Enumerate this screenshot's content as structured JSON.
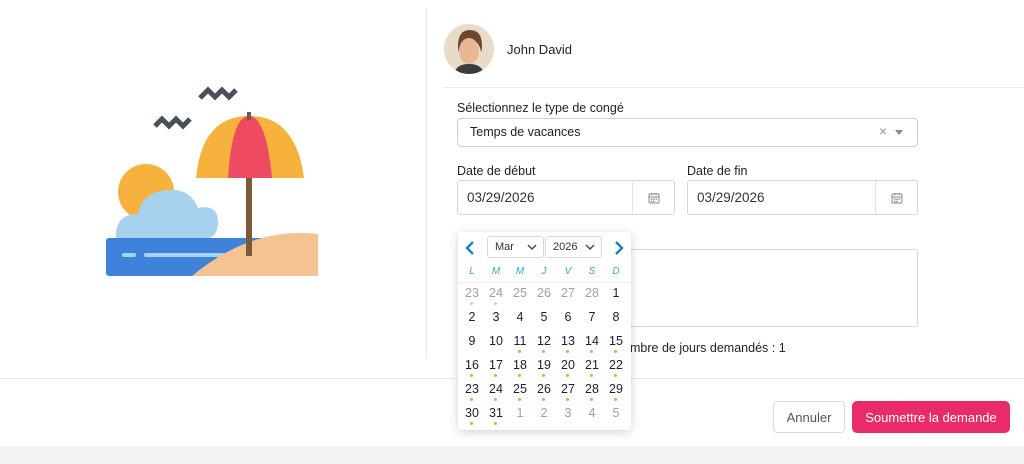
{
  "user": {
    "name": "John David"
  },
  "form": {
    "leave_type_label": "Sélectionnez le type de congé",
    "leave_type_value": "Temps de vacances",
    "clear_symbol": "×",
    "start_label": "Date de début",
    "start_value": "03/29/2026",
    "end_label": "Date de fin",
    "end_value": "03/29/2026",
    "days_text": "mbre de jours demandés : 1"
  },
  "buttons": {
    "cancel": "Annuler",
    "submit": "Soumettre la demande"
  },
  "calendar": {
    "month": "Mar",
    "year": "2026",
    "weekdays": [
      "L",
      "M",
      "M",
      "J",
      "V",
      "S",
      "D"
    ],
    "weeks": [
      [
        {
          "d": "23",
          "muted": true,
          "dot": "grey"
        },
        {
          "d": "24",
          "muted": true,
          "dot": "grey"
        },
        {
          "d": "25",
          "muted": true
        },
        {
          "d": "26",
          "muted": true
        },
        {
          "d": "27",
          "muted": true
        },
        {
          "d": "28",
          "muted": true
        },
        {
          "d": "1"
        }
      ],
      [
        {
          "d": "2"
        },
        {
          "d": "3"
        },
        {
          "d": "4"
        },
        {
          "d": "5"
        },
        {
          "d": "6"
        },
        {
          "d": "7"
        },
        {
          "d": "8"
        }
      ],
      [
        {
          "d": "9"
        },
        {
          "d": "10"
        },
        {
          "d": "11",
          "dot": "orange"
        },
        {
          "d": "12",
          "dot": "orange"
        },
        {
          "d": "13",
          "dot": "orange"
        },
        {
          "d": "14",
          "dot": "orange"
        },
        {
          "d": "15",
          "dot": "orange"
        }
      ],
      [
        {
          "d": "16",
          "dot": "orange"
        },
        {
          "d": "17",
          "dot": "orange"
        },
        {
          "d": "18",
          "dot": "orange"
        },
        {
          "d": "19",
          "dot": "orange"
        },
        {
          "d": "20",
          "dot": "orange"
        },
        {
          "d": "21",
          "dot": "orange"
        },
        {
          "d": "22",
          "dot": "orange"
        }
      ],
      [
        {
          "d": "23",
          "dot": "orange"
        },
        {
          "d": "24",
          "dot": "orange"
        },
        {
          "d": "25",
          "dot": "orange"
        },
        {
          "d": "26",
          "dot": "orange"
        },
        {
          "d": "27",
          "dot": "orange"
        },
        {
          "d": "28",
          "dot": "orange"
        },
        {
          "d": "29",
          "dot": "orange"
        }
      ],
      [
        {
          "d": "30",
          "dot": "orange"
        },
        {
          "d": "31",
          "dot": "orange"
        },
        {
          "d": "1",
          "muted": true
        },
        {
          "d": "2",
          "muted": true
        },
        {
          "d": "3",
          "muted": true
        },
        {
          "d": "4",
          "muted": true
        },
        {
          "d": "5",
          "muted": true
        }
      ]
    ]
  },
  "colors": {
    "accent": "#ea2b6a",
    "calendar_blue": "#1f7fb6",
    "dot_orange": "#e7a638"
  },
  "icons": [
    "beach-illustration",
    "calendar-icon",
    "chevron-left-icon",
    "chevron-right-icon",
    "chevron-down-icon",
    "clear-icon",
    "caret-down-icon"
  ]
}
